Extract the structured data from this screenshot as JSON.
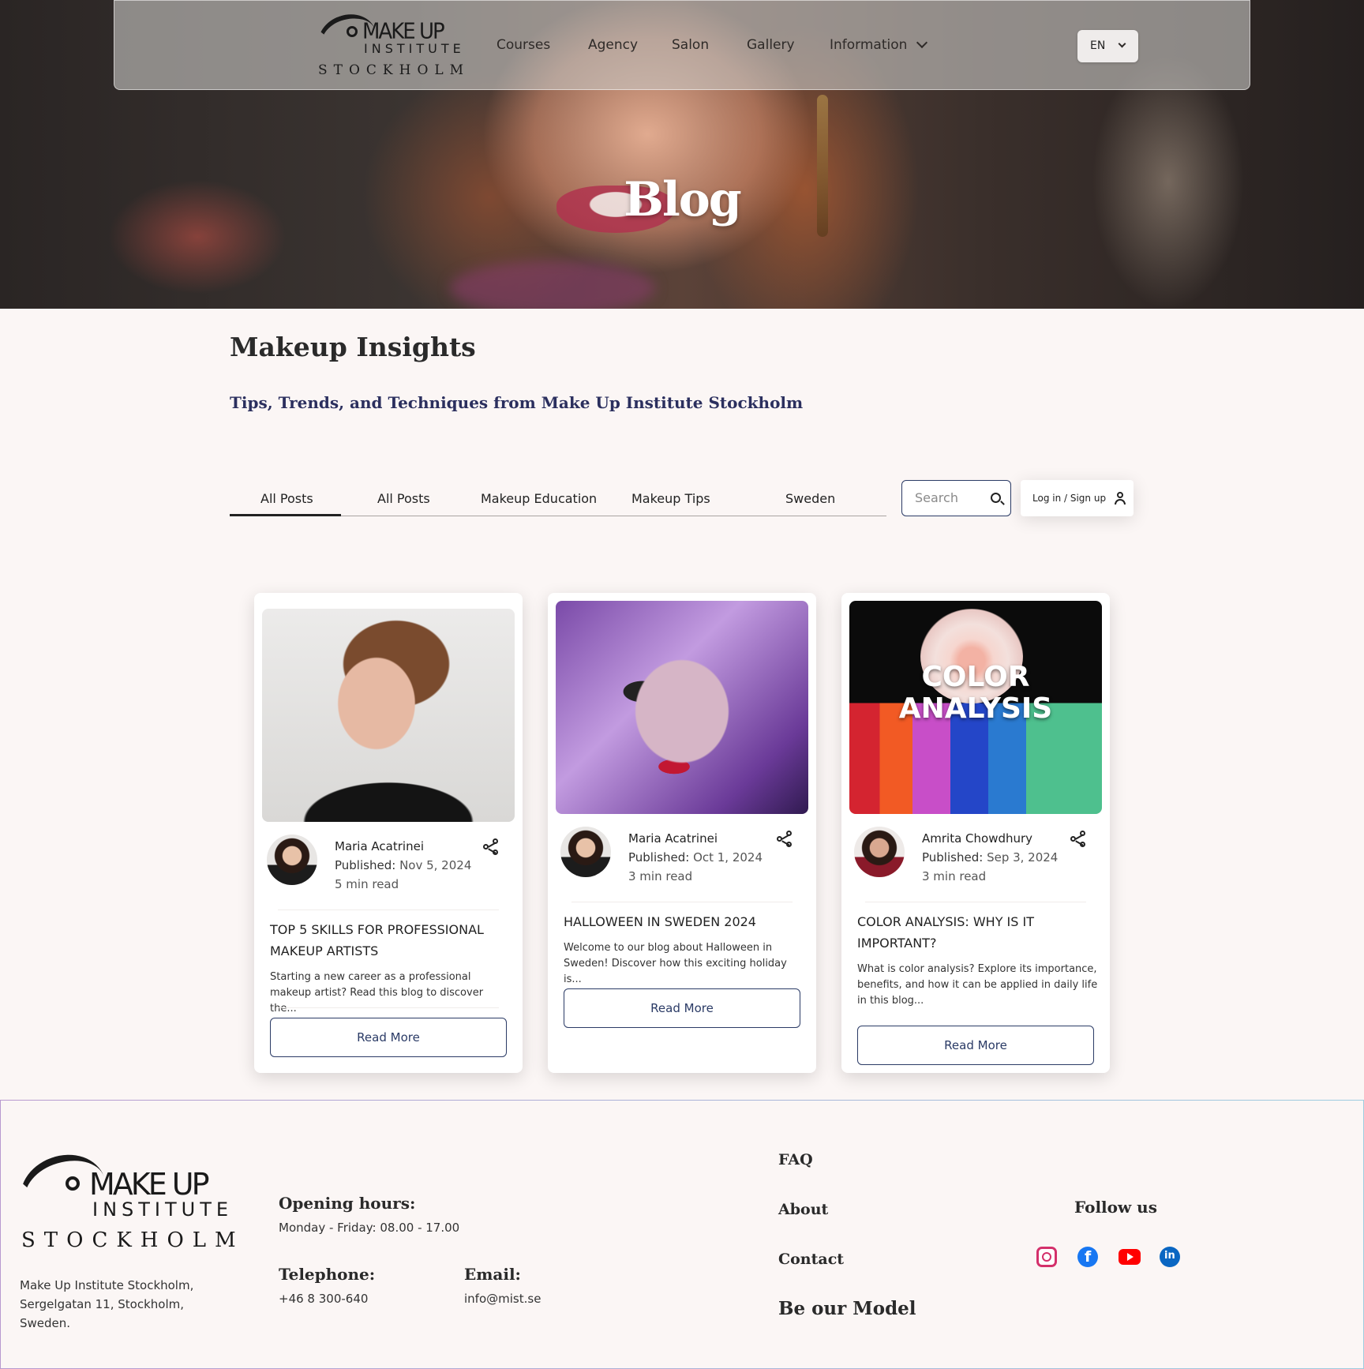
{
  "brand": {
    "logo_line1": "MAKE UP",
    "logo_line2": "INSTITUTE",
    "logo_line3": "STOCKHOLM"
  },
  "nav": {
    "items": [
      "Courses",
      "Agency",
      "Salon",
      "Gallery",
      "Information"
    ],
    "language": "EN"
  },
  "hero": {
    "title": "Blog"
  },
  "page": {
    "heading": "Makeup Insights",
    "subheading": "Tips, Trends, and Techniques from Make Up Institute Stockholm"
  },
  "tabs": {
    "items": [
      "All Posts",
      "All Posts",
      "Makeup Education",
      "Makeup Tips",
      "Sweden"
    ],
    "active": 0
  },
  "search": {
    "placeholder": "Search"
  },
  "login": {
    "label": "Log in / Sign up"
  },
  "posts": [
    {
      "author": "Maria Acatrinei",
      "published_label": "Published:",
      "date": "Nov 5, 2024",
      "read_time": "5 min read",
      "title": "TOP 5 SKILLS FOR PROFESSIONAL MAKEUP ARTISTS",
      "excerpt": "Starting a new career as a professional makeup artist? Read this blog to discover the...",
      "cta": "Read More"
    },
    {
      "author": "Maria Acatrinei",
      "published_label": "Published:",
      "date": "Oct 1, 2024",
      "read_time": "3 min read",
      "title": "HALLOWEEN IN SWEDEN 2024",
      "excerpt": "Welcome to our blog about Halloween in Sweden! Discover how this exciting holiday is...",
      "cta": "Read More"
    },
    {
      "author": "Amrita Chowdhury",
      "published_label": "Published:",
      "date": "Sep 3, 2024",
      "read_time": "3 min read",
      "title": "COLOR ANALYSIS: WHY IS IT IMPORTANT?",
      "excerpt": "What is color analysis? Explore its importance, benefits, and how it can be applied in daily life in this blog...",
      "cta": "Read More",
      "image_text_1": "COLOR",
      "image_text_2": "ANALYSIS"
    }
  ],
  "footer": {
    "address_line1": "Make Up Institute Stockholm,",
    "address_line2": "Sergelgatan 11, Stockholm, Sweden.",
    "hours_heading": "Opening hours:",
    "hours_value": "Monday - Friday: 08.00  - 17.00",
    "phone_heading": "Telephone:",
    "phone_value": "+46 8 300-640",
    "email_heading": "Email:",
    "email_value": "info@mist.se",
    "links": [
      "FAQ",
      "About",
      "Contact",
      "Be our Model"
    ],
    "follow_heading": "Follow us",
    "social_icons": [
      "instagram-icon",
      "facebook-icon",
      "youtube-icon",
      "linkedin-icon"
    ]
  },
  "colors": {
    "background": "#fbf6f5",
    "accent_navy": "#2b3b66",
    "subheading": "#2b2f5e"
  }
}
